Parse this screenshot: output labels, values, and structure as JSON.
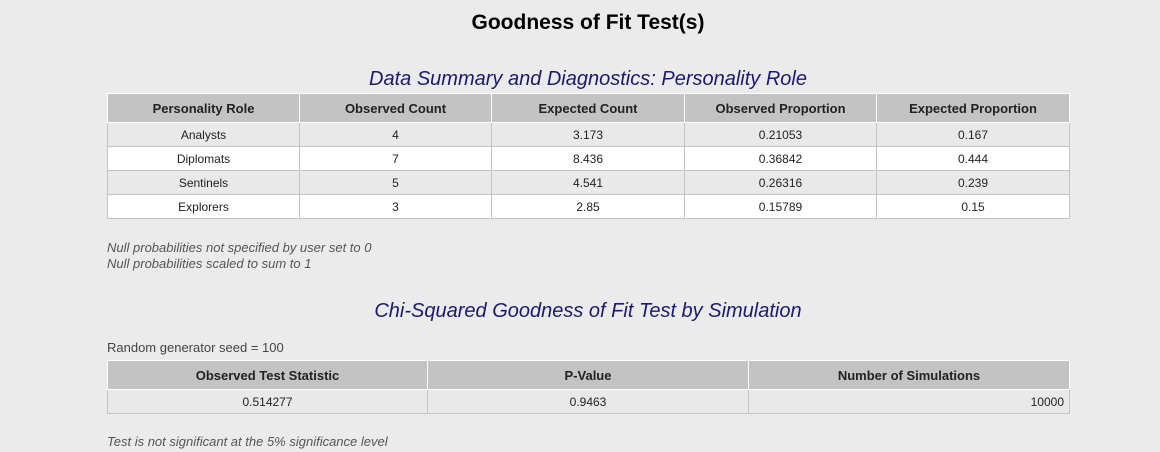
{
  "title": "Goodness of Fit Test(s)",
  "summary": {
    "heading": "Data Summary and Diagnostics: Personality Role",
    "columns": [
      "Personality Role",
      "Observed Count",
      "Expected Count",
      "Observed Proportion",
      "Expected Proportion"
    ],
    "rows": [
      [
        "Analysts",
        "4",
        "3.173",
        "0.21053",
        "0.167"
      ],
      [
        "Diplomats",
        "7",
        "8.436",
        "0.36842",
        "0.444"
      ],
      [
        "Sentinels",
        "5",
        "4.541",
        "0.26316",
        "0.239"
      ],
      [
        "Explorers",
        "3",
        "2.85",
        "0.15789",
        "0.15"
      ]
    ],
    "notes": [
      "Null probabilities not specified by user set to 0",
      "Null probabilities scaled to sum to 1"
    ]
  },
  "chisq": {
    "heading": "Chi-Squared Goodness of Fit Test by Simulation",
    "seed_text": "Random generator seed = 100",
    "columns": [
      "Observed Test Statistic",
      "P-Value",
      "Number of Simulations"
    ],
    "row": [
      "0.514277",
      "0.9463",
      "10000"
    ],
    "conclusion": "Test is not significant at the 5% significance level"
  }
}
